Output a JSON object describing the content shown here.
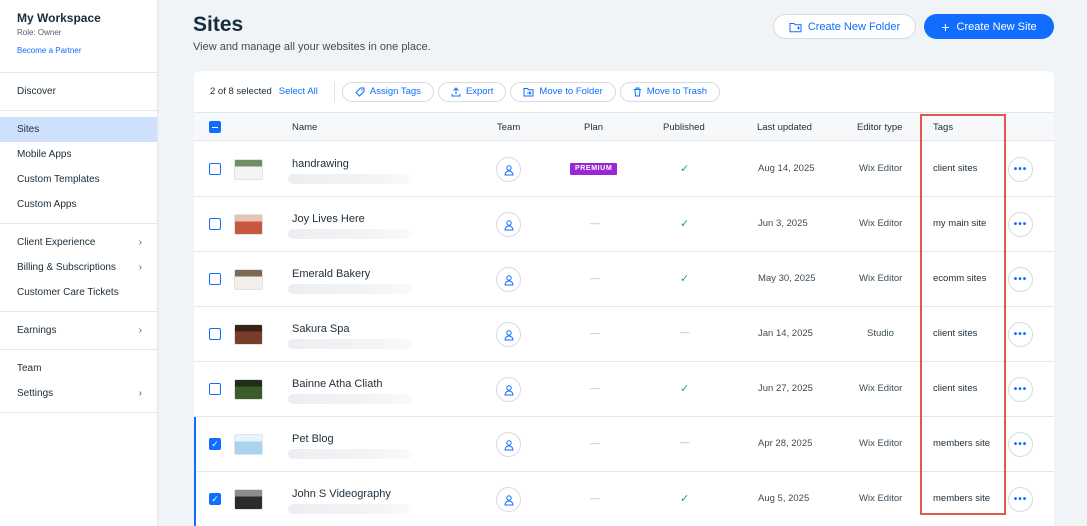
{
  "sidebar": {
    "workspace_title": "My Workspace",
    "role": "Role: Owner",
    "partner_link": "Become a Partner",
    "groups": [
      [
        {
          "label": "Discover",
          "chevron": false,
          "active": false
        }
      ],
      [
        {
          "label": "Sites",
          "chevron": false,
          "active": true
        },
        {
          "label": "Mobile Apps",
          "chevron": false,
          "active": false
        },
        {
          "label": "Custom Templates",
          "chevron": false,
          "active": false
        },
        {
          "label": "Custom Apps",
          "chevron": false,
          "active": false
        }
      ],
      [
        {
          "label": "Client Experience",
          "chevron": true,
          "active": false
        },
        {
          "label": "Billing & Subscriptions",
          "chevron": true,
          "active": false
        },
        {
          "label": "Customer Care Tickets",
          "chevron": false,
          "active": false
        }
      ],
      [
        {
          "label": "Earnings",
          "chevron": true,
          "active": false
        }
      ],
      [
        {
          "label": "Team",
          "chevron": false,
          "active": false
        },
        {
          "label": "Settings",
          "chevron": true,
          "active": false
        }
      ]
    ]
  },
  "header": {
    "title": "Sites",
    "subtitle": "View and manage all your websites in one place.",
    "create_folder": "Create New Folder",
    "create_site": "Create New Site"
  },
  "toolbar": {
    "selected": "2 of 8 selected",
    "select_all": "Select All",
    "assign_tags": "Assign Tags",
    "export": "Export",
    "move_to_folder": "Move to Folder",
    "move_to_trash": "Move to Trash"
  },
  "table": {
    "headers": {
      "name": "Name",
      "team": "Team",
      "plan": "Plan",
      "published": "Published",
      "last_updated": "Last updated",
      "editor_type": "Editor type",
      "tags": "Tags"
    },
    "rows": [
      {
        "name": "handrawing",
        "plan": "PREMIUM",
        "published": "✓",
        "updated": "Aug 14, 2025",
        "editor": "Wix Editor",
        "tag": "client sites",
        "checked": false,
        "thumb": [
          "#f4f4f2",
          "#6e8e66"
        ]
      },
      {
        "name": "Joy Lives Here",
        "plan": "—",
        "published": "✓",
        "updated": "Jun 3, 2025",
        "editor": "Wix Editor",
        "tag": "my main site",
        "checked": false,
        "thumb": [
          "#c9563f",
          "#e8c2b6"
        ]
      },
      {
        "name": "Emerald Bakery",
        "plan": "—",
        "published": "✓",
        "updated": "May 30, 2025",
        "editor": "Wix Editor",
        "tag": "ecomm sites",
        "checked": false,
        "thumb": [
          "#f1efe9",
          "#7a6a55"
        ]
      },
      {
        "name": "Sakura Spa",
        "plan": "—",
        "published": "—",
        "updated": "Jan 14, 2025",
        "editor": "Studio",
        "tag": "client sites",
        "checked": false,
        "thumb": [
          "#7a3d2a",
          "#3b2217"
        ]
      },
      {
        "name": "Bainne Atha Cliath",
        "plan": "—",
        "published": "✓",
        "updated": "Jun 27, 2025",
        "editor": "Wix Editor",
        "tag": "client sites",
        "checked": false,
        "thumb": [
          "#3e5b2c",
          "#1f2e16"
        ]
      },
      {
        "name": "Pet Blog",
        "plan": "—",
        "published": "—",
        "updated": "Apr 28, 2025",
        "editor": "Wix Editor",
        "tag": "members site",
        "checked": true,
        "thumb": [
          "#a9d3ef",
          "#e8f3fa"
        ]
      },
      {
        "name": "John S Videography",
        "plan": "—",
        "published": "✓",
        "updated": "Aug 5, 2025",
        "editor": "Wix Editor",
        "tag": "members site",
        "checked": true,
        "thumb": [
          "#2b2b2b",
          "#8c8c8c"
        ]
      }
    ]
  },
  "colors": {
    "accent": "#116dff",
    "premium": "#9a27d5",
    "highlight": "#e05a4b",
    "success": "#25a55a"
  }
}
